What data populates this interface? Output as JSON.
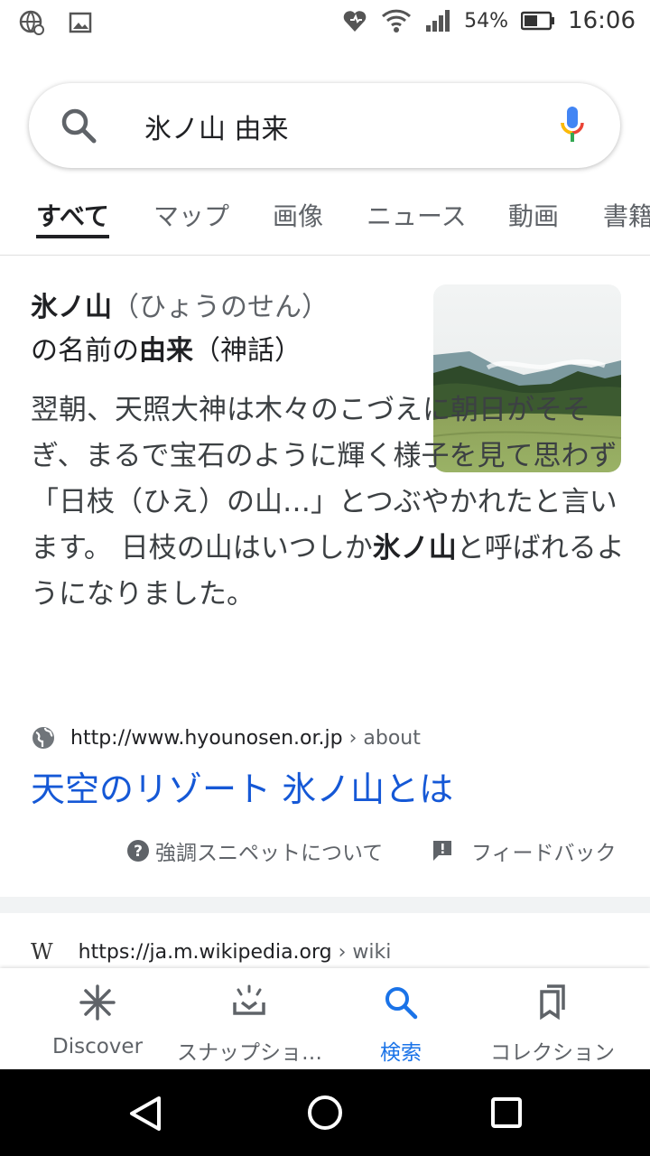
{
  "status": {
    "battery": "54%",
    "time": "16:06"
  },
  "search": {
    "query": "氷ノ山 由来"
  },
  "tabs": [
    "すべて",
    "マップ",
    "画像",
    "ニュース",
    "動画",
    "書籍"
  ],
  "snippet": {
    "title_bold": "氷ノ山",
    "title_reading": "（ひょうのせん）",
    "title_line2_a": "の名前の",
    "title_line2_bold": "由来",
    "title_line2_b": "（神話）",
    "body_a": "翌朝、天照大神は木々のこづえに朝日がそそぎ、まるで宝石のように輝く様子を見て思わず「日枝（ひえ）の山…」とつぶやかれたと言います。 日枝の山はいつしか",
    "body_bold": "氷ノ山",
    "body_b": "と呼ばれるようになりました。",
    "source_url": "http://www.hyounosen.or.jp",
    "source_crumb": " › about",
    "link_title": "天空のリゾート 氷ノ山とは",
    "about_label": "強調スニペットについて",
    "feedback_label": "フィードバック"
  },
  "next_result": {
    "site_icon": "W",
    "url": "https://ja.m.wikipedia.org",
    "crumb": " › wiki"
  },
  "bottom_nav": {
    "discover": "Discover",
    "snapshot": "スナップショ…",
    "search": "検索",
    "collections": "コレクション"
  },
  "colors": {
    "accent": "#1a73e8",
    "link": "#1558d6"
  }
}
